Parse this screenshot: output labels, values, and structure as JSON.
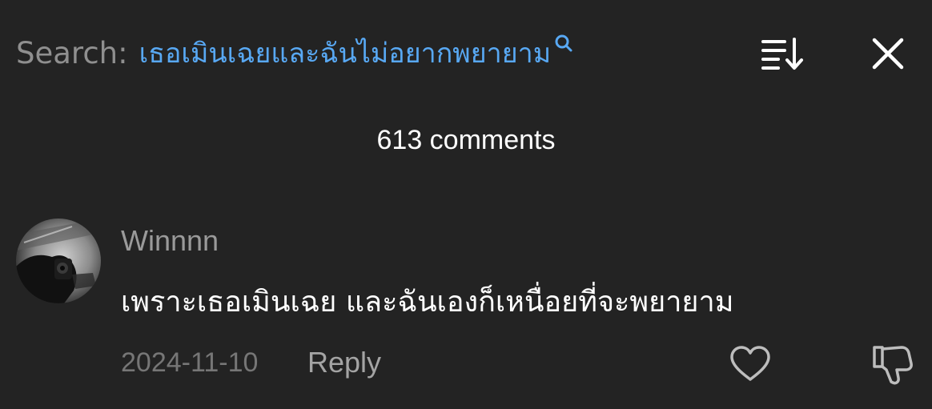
{
  "search": {
    "label": "Search:",
    "query": "เธอเมินเฉยและฉันไม่อยากพยายาม",
    "icon": "search-icon"
  },
  "toolbar": {
    "sort_icon": "sort-icon",
    "close_icon": "close-icon"
  },
  "comments_header": {
    "count_text": "613 comments"
  },
  "comments": [
    {
      "username": "Winnnn",
      "avatar": "avatar",
      "text": "เพราะเธอเมินเฉย และฉันเองก็เหนื่อยที่จะพยายาม",
      "date": "2024-11-10",
      "reply_label": "Reply",
      "like_icon": "heart-icon",
      "dislike_icon": "thumbs-down-icon"
    }
  ],
  "colors": {
    "background": "#232323",
    "search_label": "#8f8f8f",
    "search_query": "#58a8f3",
    "username": "#9a9a9a",
    "date": "#767676",
    "reply": "#a4a4a4",
    "icon": "#ffffff",
    "action_icon": "#bdbdbd"
  }
}
